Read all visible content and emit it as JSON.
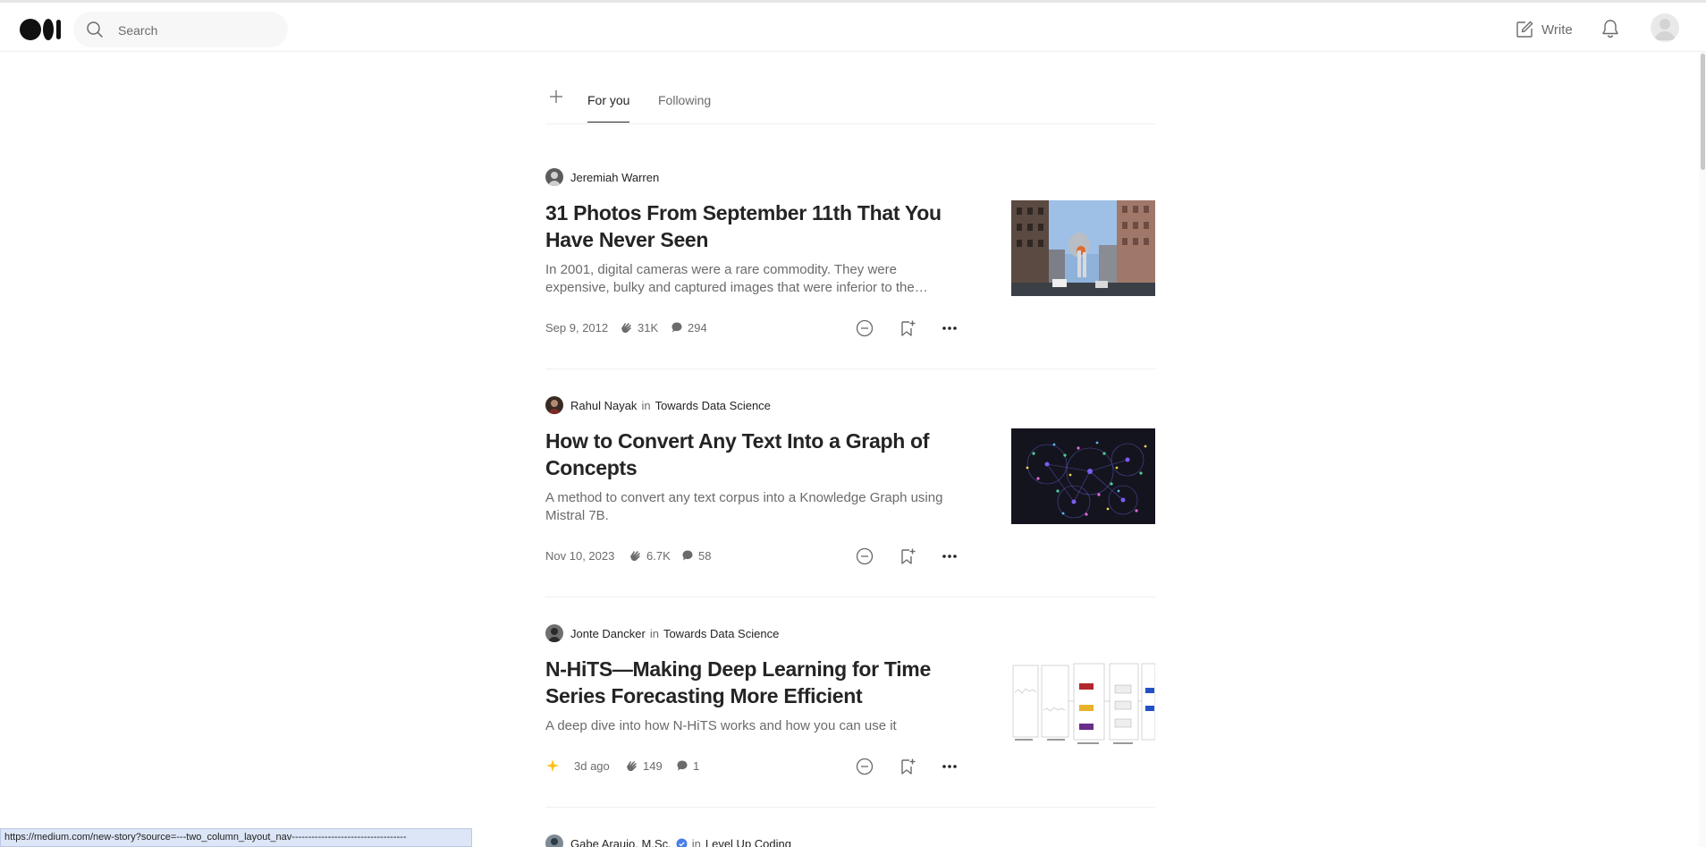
{
  "header": {
    "search_placeholder": "Search",
    "write_label": "Write",
    "logo_icon": "medium-logo-icon"
  },
  "tabs": [
    {
      "label": "For you",
      "active": true
    },
    {
      "label": "Following",
      "active": false
    }
  ],
  "articles": [
    {
      "author": "Jeremiah Warren",
      "publication": "",
      "title": "31 Photos From September 11th That You Have Never Seen",
      "subtitle": "In 2001, digital cameras were a rare commodity. They were expensive, bulky and captured images that were inferior to the…",
      "date": "Sep 9, 2012",
      "claps": "31K",
      "comments": "294",
      "thumbnail": "city-street-smoke-photo"
    },
    {
      "author": "Rahul Nayak",
      "in": "in",
      "publication": "Towards Data Science",
      "title": "How to Convert Any Text Into a Graph of Concepts",
      "subtitle": "A method to convert any text corpus into a Knowledge Graph using Mistral 7B.",
      "date": "Nov 10, 2023",
      "claps": "6.7K",
      "comments": "58",
      "thumbnail": "knowledge-graph-network-image"
    },
    {
      "author": "Jonte Dancker",
      "in": "in",
      "publication": "Towards Data Science",
      "title": "N-HiTS—Making Deep Learning for Time Series Forecasting More Efficient",
      "subtitle": "A deep dive into how N-HiTS works and how you can use it",
      "date": "3d ago",
      "claps": "149",
      "comments": "1",
      "member_only": true,
      "thumbnail": "architecture-diagram-image"
    },
    {
      "author": "Gabe Araujo, M.Sc.",
      "in": "in",
      "publication": "Level Up Coding"
    }
  ],
  "status_url": "https://medium.com/new-story?source=---two_column_layout_nav-----------------------------------",
  "colors": {
    "text": "#242424",
    "muted": "#6b6b6b",
    "star": "#ffc017",
    "verified": "#4a7ee8"
  }
}
